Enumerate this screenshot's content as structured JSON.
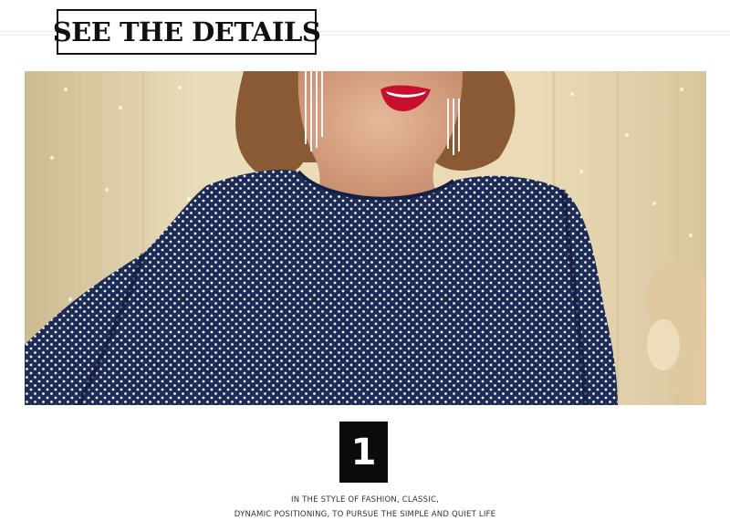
{
  "header": {
    "title": "SEE THE DETAILS"
  },
  "detail": {
    "number": "1"
  },
  "caption": {
    "line1": "IN THE STYLE OF FASHION, CLASSIC,",
    "line2": "DYNAMIC POSITIONING, TO PURSUE THE SIMPLE AND QUIET LIFE"
  },
  "colors": {
    "dress": "#1d2b57",
    "background_wall": "#e7d7b1",
    "lips": "#c8102e",
    "skin": "#d9a889",
    "hair": "#8a5a34"
  },
  "photo": {
    "subject": "model-in-navy-polka-dot-dress"
  }
}
